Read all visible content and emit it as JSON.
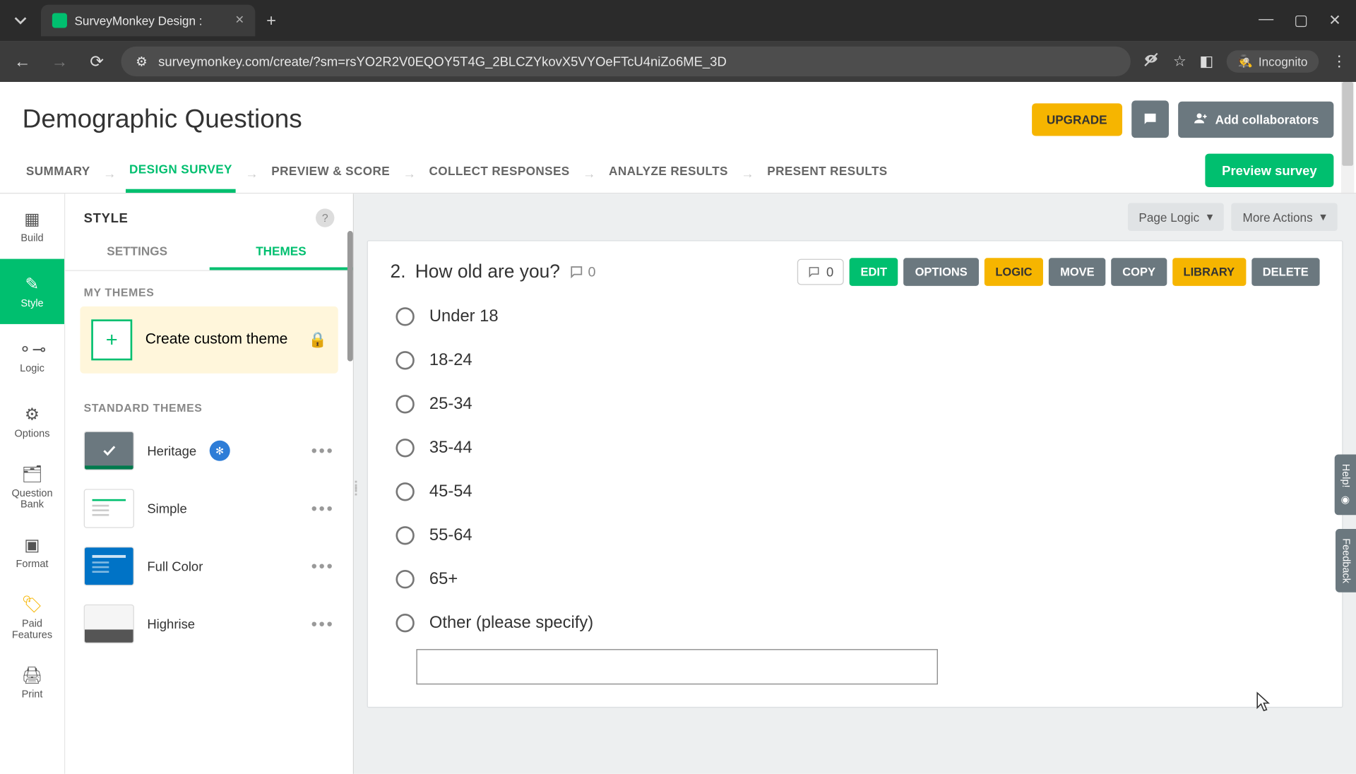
{
  "browser": {
    "tab_title": "SurveyMonkey Design :",
    "url": "surveymonkey.com/create/?sm=rsYO2R2V0EQOY5T4G_2BLCZYkovX5VYOeFTcU4niZo6ME_3D",
    "incognito_label": "Incognito"
  },
  "header": {
    "title": "Demographic Questions",
    "upgrade": "UPGRADE",
    "add_collab": "Add collaborators"
  },
  "nav": {
    "steps": [
      "SUMMARY",
      "DESIGN SURVEY",
      "PREVIEW & SCORE",
      "COLLECT RESPONSES",
      "ANALYZE RESULTS",
      "PRESENT RESULTS"
    ],
    "active_index": 1,
    "preview": "Preview survey"
  },
  "rail": {
    "items": [
      "Build",
      "Style",
      "Logic",
      "Options",
      "Question Bank",
      "Format",
      "Paid Features",
      "Print"
    ],
    "active_index": 1
  },
  "panel": {
    "title": "STYLE",
    "tabs": [
      "SETTINGS",
      "THEMES"
    ],
    "active_tab": 1,
    "my_themes_label": "MY THEMES",
    "create_custom": "Create custom theme",
    "standard_label": "STANDARD THEMES",
    "themes": [
      {
        "name": "Heritage",
        "selected": true,
        "accessible": true
      },
      {
        "name": "Simple",
        "selected": false,
        "accessible": false
      },
      {
        "name": "Full Color",
        "selected": false,
        "accessible": false
      },
      {
        "name": "Highrise",
        "selected": false,
        "accessible": false
      }
    ]
  },
  "canvas": {
    "page_logic": "Page Logic",
    "more_actions": "More Actions",
    "question": {
      "number": "2.",
      "text": "How old are you?",
      "comment_count": "0",
      "toolbar_count": "0",
      "buttons": {
        "edit": "EDIT",
        "options": "OPTIONS",
        "logic": "LOGIC",
        "move": "MOVE",
        "copy": "COPY",
        "library": "LIBRARY",
        "delete": "DELETE"
      },
      "options": [
        "Under 18",
        "18-24",
        "25-34",
        "35-44",
        "45-54",
        "55-64",
        "65+",
        "Other (please specify)"
      ]
    }
  },
  "float": {
    "help": "Help!",
    "feedback": "Feedback"
  }
}
